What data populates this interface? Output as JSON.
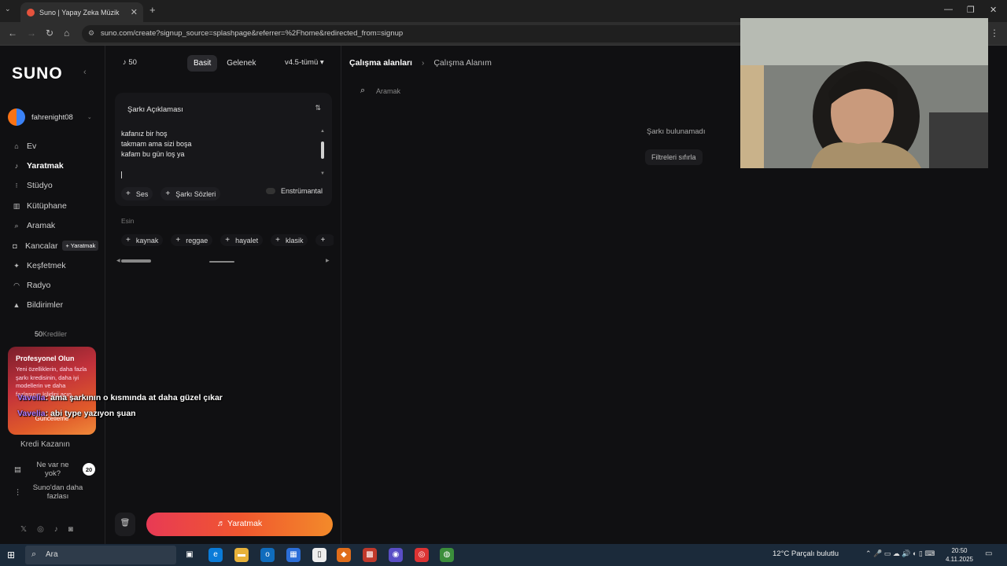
{
  "browser": {
    "tab_title": "Suno | Yapay Zeka Müzik",
    "url": "suno.com/create?signup_source=splashpage&referrer=%2Fhome&redirected_from=signup"
  },
  "sidebar": {
    "logo": "SUNO",
    "username": "fahrenight08",
    "items": [
      {
        "label": "Ev",
        "icon": "home-icon"
      },
      {
        "label": "Yaratmak",
        "icon": "music-note-icon",
        "active": true
      },
      {
        "label": "Stüdyo",
        "icon": "studio-icon"
      },
      {
        "label": "Kütüphane",
        "icon": "library-icon"
      },
      {
        "label": "Aramak",
        "icon": "search-icon"
      },
      {
        "label": "Kancalar",
        "icon": "hook-icon",
        "badge": "+ Yaratmak"
      },
      {
        "label": "Keşfetmek",
        "icon": "compass-icon"
      },
      {
        "label": "Radyo",
        "icon": "radio-icon"
      },
      {
        "label": "Bildirimler",
        "icon": "bell-icon"
      }
    ],
    "credits_count": "50",
    "credits_label": "Krediler",
    "pro_title": "Profesyonel Olun",
    "pro_desc": "Yeni özelliklerin, daha fazla şarkı kredisinin, daha iyi modellerin ve daha fazlasının kilidini açın",
    "pro_button": "Güncelleme",
    "earn_credits": "Kredi Kazanın",
    "whats_new": "Ne var ne yok?",
    "whats_new_count": "20",
    "more_from_suno": "Suno'dan daha fazlası"
  },
  "create": {
    "credits": "50",
    "modes": [
      "Basit",
      "Gelenek"
    ],
    "active_mode": "Basit",
    "version": "v4.5-tümü",
    "description_title": "Şarkı Açıklaması",
    "lyrics": "kafanız bir hoş\ntakmam ama sizi boşa\nkafam bu gün loş ya",
    "chips": [
      "Ses",
      "Şarkı Sözleri"
    ],
    "instrumental": "Enstrümantal",
    "inspiration_label": "Esin",
    "tags": [
      "kaynak",
      "reggae",
      "hayalet",
      "klasik"
    ],
    "create_button": "Yaratmak"
  },
  "workspace": {
    "breadcrumb_root": "Çalışma alanları",
    "breadcrumb_current": "Çalışma Alanım",
    "search_placeholder": "Aramak",
    "empty_text": "Şarkı bulunamadı",
    "reset_filters": "Filtreleri sıfırla"
  },
  "chat": [
    {
      "user": "Vavelia",
      "message": ": ama şarkının o kısmında at daha güzel çıkar"
    },
    {
      "user": "Vavelia",
      "message": ": abi type yazıyon şuan"
    }
  ],
  "taskbar": {
    "search_placeholder": "Ara",
    "weather": "12°C  Parçalı bulutlu",
    "time": "20:50",
    "date": "4.11.2025"
  }
}
